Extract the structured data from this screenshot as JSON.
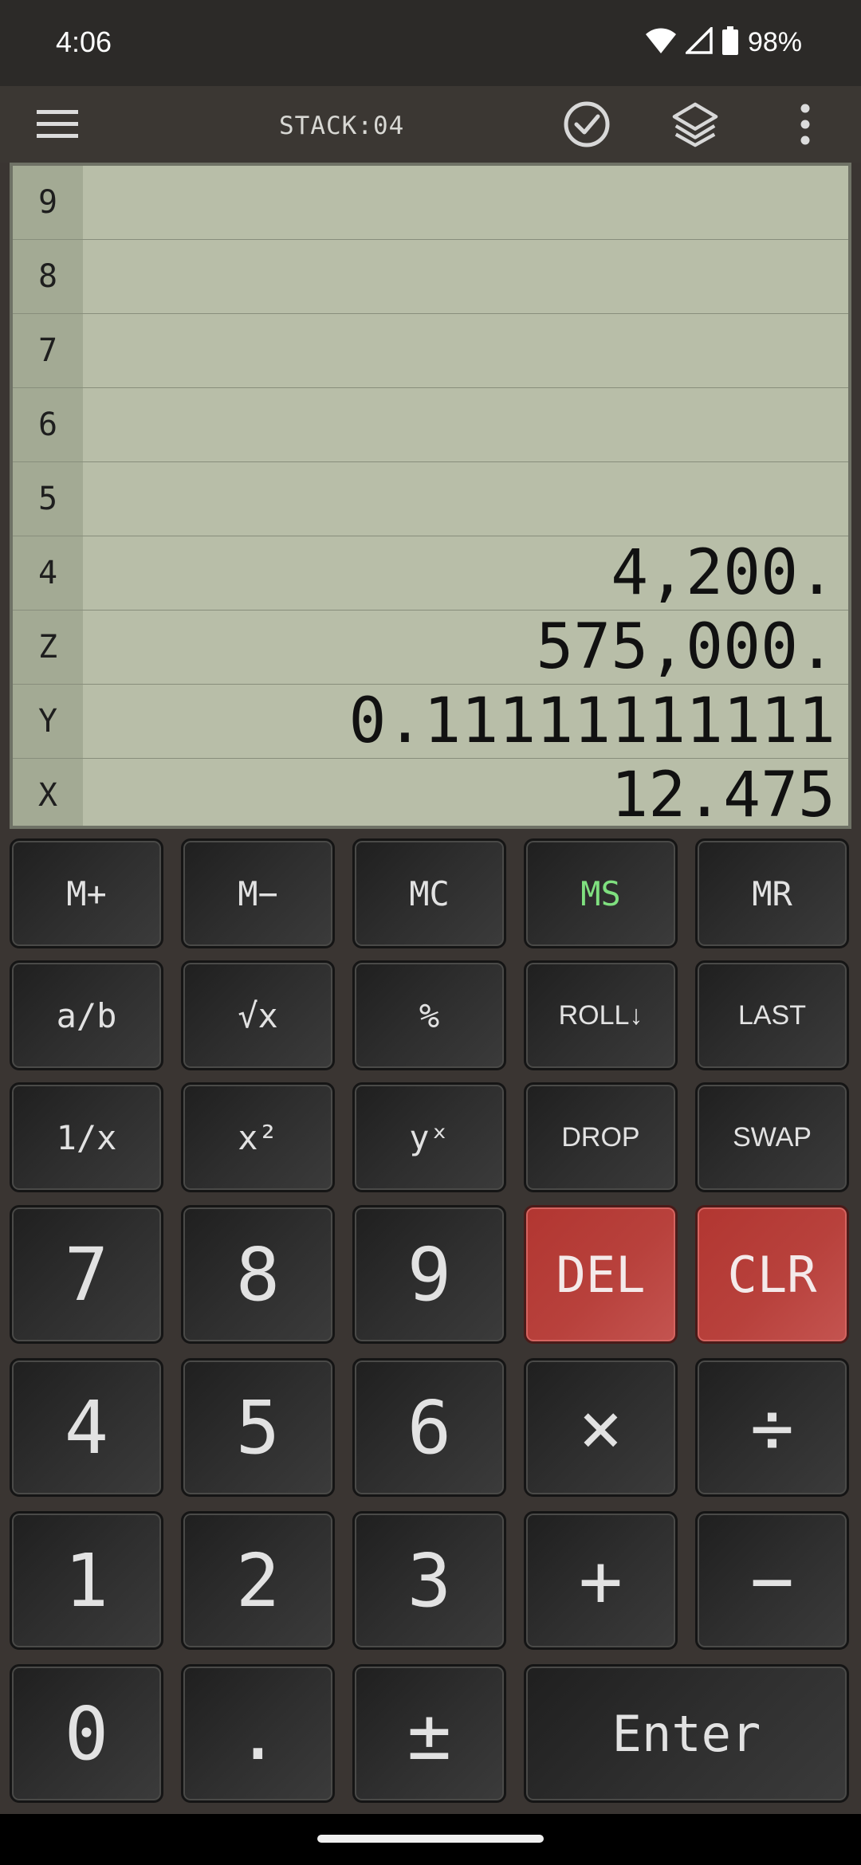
{
  "status_bar": {
    "time": "4:06",
    "battery_percent": "98%",
    "icons": [
      "wifi-icon",
      "cellular-signal-icon",
      "battery-icon"
    ]
  },
  "toolbar": {
    "menu_icon": "hamburger-menu-icon",
    "stack_label": "STACK:04",
    "history_icon": "clock-icon",
    "layers_icon": "layers-icon",
    "more_icon": "more-vert-icon"
  },
  "stack": {
    "rows": [
      {
        "label": "9",
        "value": ""
      },
      {
        "label": "8",
        "value": ""
      },
      {
        "label": "7",
        "value": ""
      },
      {
        "label": "6",
        "value": ""
      },
      {
        "label": "5",
        "value": ""
      },
      {
        "label": "4",
        "value": "4,200."
      },
      {
        "label": "Z",
        "value": "575,000."
      },
      {
        "label": "Y",
        "value": "0.11111111111"
      },
      {
        "label": "X",
        "value": "12.475"
      }
    ]
  },
  "keypad": {
    "memory": {
      "m_plus": "M+",
      "m_minus": "M−",
      "mc": "MC",
      "ms": "MS",
      "mr": "MR"
    },
    "functions1": {
      "fraction": "a/b",
      "sqrt": "√x",
      "percent": "%",
      "roll_down": "ROLL↓",
      "last": "LAST"
    },
    "functions2": {
      "reciprocal": "1/x",
      "square": "x²",
      "power": "yˣ",
      "drop": "DROP",
      "swap": "SWAP"
    },
    "digits": {
      "d7": "7",
      "d8": "8",
      "d9": "9",
      "d4": "4",
      "d5": "5",
      "d6": "6",
      "d1": "1",
      "d2": "2",
      "d3": "3",
      "d0": "0"
    },
    "ops": {
      "del": "DEL",
      "clr": "CLR",
      "multiply": "×",
      "divide": "÷",
      "plus": "+",
      "minus": "−",
      "decimal": ".",
      "plus_minus": "±",
      "enter": "Enter"
    },
    "colors": {
      "ms_text": "#7fe07f",
      "danger_key": "#b8413c"
    }
  }
}
